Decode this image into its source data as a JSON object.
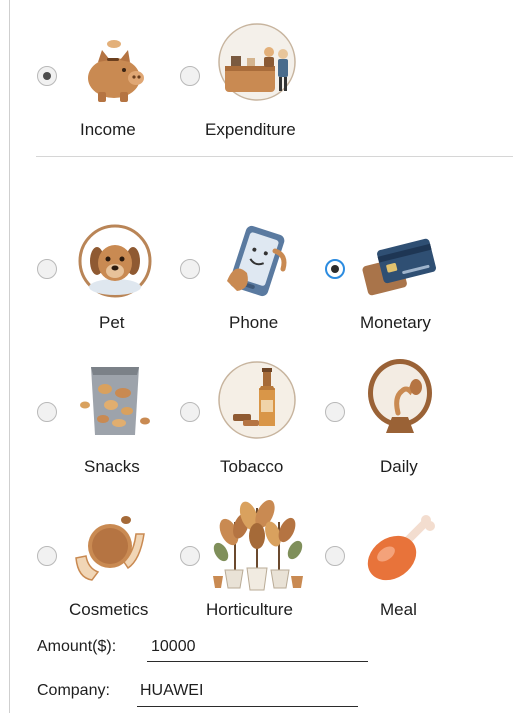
{
  "type_group": {
    "options": [
      {
        "label": "Income",
        "icon": "piggy-bank-icon",
        "checked": true
      },
      {
        "label": "Expenditure",
        "icon": "reception-desk-icon",
        "checked": false
      }
    ]
  },
  "category_group": {
    "options": [
      {
        "label": "Pet",
        "icon": "dog-icon",
        "checked": false
      },
      {
        "label": "Phone",
        "icon": "phone-icon",
        "checked": false
      },
      {
        "label": "Monetary",
        "icon": "credit-card-icon",
        "checked": true
      },
      {
        "label": "Snacks",
        "icon": "chips-bag-icon",
        "checked": false
      },
      {
        "label": "Tobacco",
        "icon": "bottle-icon",
        "checked": false
      },
      {
        "label": "Daily",
        "icon": "mirror-icon",
        "checked": false
      },
      {
        "label": "Cosmetics",
        "icon": "compact-mirror-icon",
        "checked": false
      },
      {
        "label": "Horticulture",
        "icon": "potted-plants-icon",
        "checked": false
      },
      {
        "label": "Meal",
        "icon": "drumstick-icon",
        "checked": false
      }
    ]
  },
  "form": {
    "amount_label": "Amount($):",
    "amount_value": "10000",
    "company_label": "Company:",
    "company_value": "HUAWEI"
  },
  "colors": {
    "accent": "#2c8ce0",
    "divider": "#d6d6d6",
    "icon_brown": "#c98a52"
  }
}
